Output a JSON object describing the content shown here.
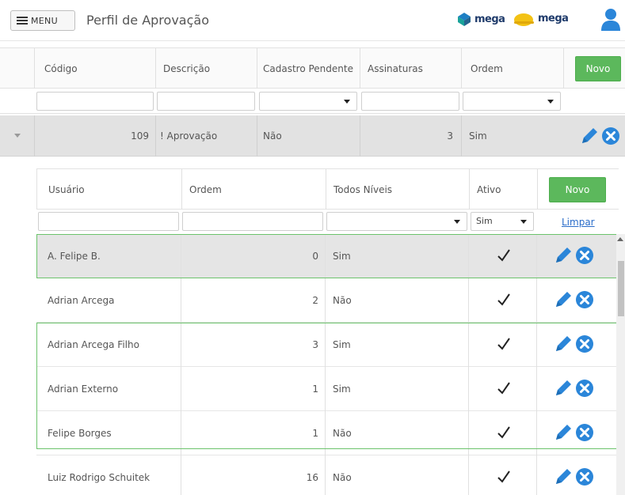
{
  "header": {
    "menu_label": "MENU",
    "title": "Perfil de Aprovação",
    "brand1": "mega",
    "brand2": "mega"
  },
  "outer_grid": {
    "columns": [
      "Código",
      "Descrição",
      "Cadastro Pendente",
      "Assinaturas",
      "Ordem"
    ],
    "new_button": "Novo",
    "row": {
      "codigo": "109",
      "descricao": "! Aprovação",
      "cadastro_pendente": "Não",
      "assinaturas": "3",
      "ordem": "Sim"
    }
  },
  "inner_grid": {
    "columns": [
      "Usuário",
      "Ordem",
      "Todos Níveis",
      "Ativo"
    ],
    "new_button": "Novo",
    "filter_ativo": "Sim",
    "clear_label": "Limpar",
    "rows": [
      {
        "usuario": "A. Felipe B.",
        "ordem": "0",
        "todos_niveis": "Sim",
        "ativo": true
      },
      {
        "usuario": "Adrian Arcega",
        "ordem": "2",
        "todos_niveis": "Não",
        "ativo": true
      },
      {
        "usuario": "Adrian Arcega Filho",
        "ordem": "3",
        "todos_niveis": "Sim",
        "ativo": true
      },
      {
        "usuario": "Adrian Externo",
        "ordem": "1",
        "todos_niveis": "Sim",
        "ativo": true
      },
      {
        "usuario": "Felipe Borges",
        "ordem": "1",
        "todos_niveis": "Não",
        "ativo": true
      },
      {
        "usuario": "Luiz Rodrigo Schuitek",
        "ordem": "16",
        "todos_niveis": "Não",
        "ativo": true
      }
    ]
  },
  "icons": {
    "menu": "hamburger-icon",
    "edit": "pencil-icon",
    "delete": "close-circle-icon",
    "check": "checkmark-icon",
    "expand": "chevron-down-icon",
    "user": "user-icon"
  },
  "colors": {
    "accent_blue": "#2b86d9",
    "novo_green": "#5cb85c",
    "selection_border": "#6cc36c"
  }
}
